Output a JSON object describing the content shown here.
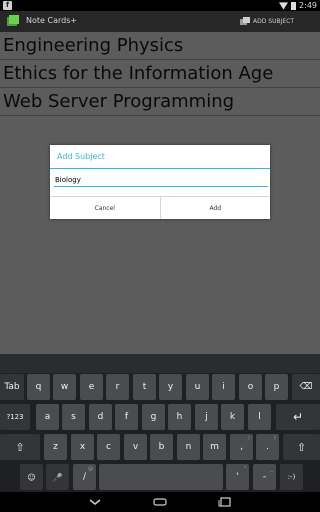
{
  "status_bar": {
    "notification_icon": "notification-icon",
    "time": "2:49"
  },
  "action_bar": {
    "title": "Note Cards+",
    "add_subject_label": "ADD SUBJECT"
  },
  "subjects": [
    "Engineering Physics",
    "Ethics for the Information Age",
    "Web Server Programming"
  ],
  "dialog": {
    "title": "Add Subject",
    "input_value": "Biology",
    "cancel_label": "Cancel",
    "add_label": "Add"
  },
  "keyboard": {
    "row1": [
      "Tab",
      "q",
      "w",
      "e",
      "r",
      "t",
      "y",
      "u",
      "i",
      "o",
      "p",
      "⌫"
    ],
    "row2": [
      "?123",
      "a",
      "s",
      "d",
      "f",
      "g",
      "h",
      "j",
      "k",
      "l",
      "↵"
    ],
    "row3": [
      "⇧",
      "z",
      "x",
      "c",
      "v",
      "b",
      "n",
      "m",
      ",",
      ".",
      "⇧"
    ],
    "row4": [
      "☺",
      "🎤",
      "/",
      " ",
      "'",
      "-",
      ":-)"
    ],
    "hints": {
      "comma": "!",
      "period": "?",
      "slash": "@",
      "apostrophe": "\"",
      "dash": "_"
    }
  },
  "colors": {
    "accent": "#33b5e5",
    "content_bg": "#5c5c5c",
    "action_bar_bg": "#272727",
    "keyboard_bg": "#1e2023",
    "key_bg": "#4a4c4e"
  }
}
